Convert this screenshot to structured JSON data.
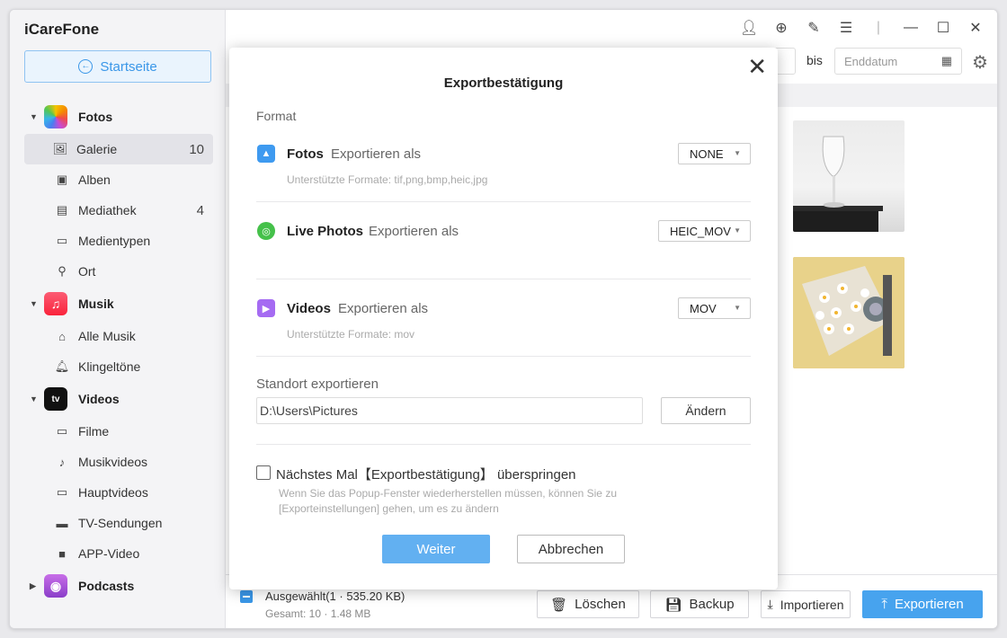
{
  "app": {
    "title": "iCareFone",
    "home_label": "Startseite"
  },
  "sidebar": {
    "sections": [
      {
        "label": "Fotos",
        "items": [
          {
            "label": "Galerie",
            "count": "10"
          },
          {
            "label": "Alben",
            "count": ""
          },
          {
            "label": "Mediathek",
            "count": "4"
          },
          {
            "label": "Medientypen",
            "count": ""
          },
          {
            "label": "Ort",
            "count": ""
          }
        ]
      },
      {
        "label": "Musik",
        "items": [
          {
            "label": "Alle Musik"
          },
          {
            "label": "Klingeltöne"
          }
        ]
      },
      {
        "label": "Videos",
        "items": [
          {
            "label": "Filme"
          },
          {
            "label": "Musikvideos"
          },
          {
            "label": "Hauptvideos"
          },
          {
            "label": "TV-Sendungen"
          },
          {
            "label": "APP-Video"
          }
        ]
      },
      {
        "label": "Podcasts"
      }
    ]
  },
  "toolbar": {
    "bis": "bis",
    "end_date_placeholder": "Enddatum"
  },
  "bottom": {
    "selected": "Ausgewählt(1 · 535.20 KB)",
    "total": "Gesamt: 10 · 1.48 MB",
    "delete": "Löschen",
    "backup": "Backup",
    "import": "Importieren",
    "export": "Exportieren"
  },
  "modal": {
    "title": "Exportbestätigung",
    "format_label": "Format",
    "photos": {
      "title": "Fotos",
      "sub": "Exportieren als",
      "value": "NONE",
      "hint": "Unterstützte Formate: tif,png,bmp,heic,jpg"
    },
    "live": {
      "title": "Live Photos",
      "sub": "Exportieren als",
      "value": "HEIC_MOV"
    },
    "videos": {
      "title": "Videos",
      "sub": "Exportieren als",
      "value": "MOV",
      "hint": "Unterstützte Formate: mov"
    },
    "location_label": "Standort exportieren",
    "path": "D:\\Users\\Pictures",
    "change": "Ändern",
    "skip_label": "Nächstes Mal【Exportbestätigung】 überspringen",
    "note": "Wenn Sie das Popup-Fenster wiederherstellen müssen, können Sie zu [Exporteinstellungen] gehen, um es zu ändern",
    "continue": "Weiter",
    "cancel": "Abbrechen"
  },
  "colors": {
    "accent": "#3a97e8",
    "primary_button": "#62b0f1"
  }
}
